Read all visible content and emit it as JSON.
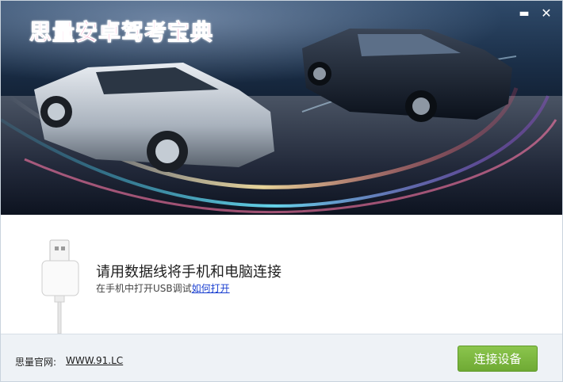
{
  "window": {
    "title": "思量安卓驾考宝典",
    "minimize_glyph": "▬",
    "close_glyph": "✕"
  },
  "banner": {
    "image_description_icon": "cars-banner-image"
  },
  "main": {
    "instruction": "请用数据线将手机和电脑连接",
    "hint_prefix": "在手机中打开USB调试",
    "hint_link": "如何打开"
  },
  "footer": {
    "site_label": "思量官网:",
    "site_link": "WWW.91.LC",
    "connect_button": "连接设备"
  },
  "colors": {
    "title_pink": "#ff3e8f",
    "link_blue": "#1a3fd0",
    "button_green": "#7ab73f",
    "footer_bg": "#eef2f6"
  }
}
